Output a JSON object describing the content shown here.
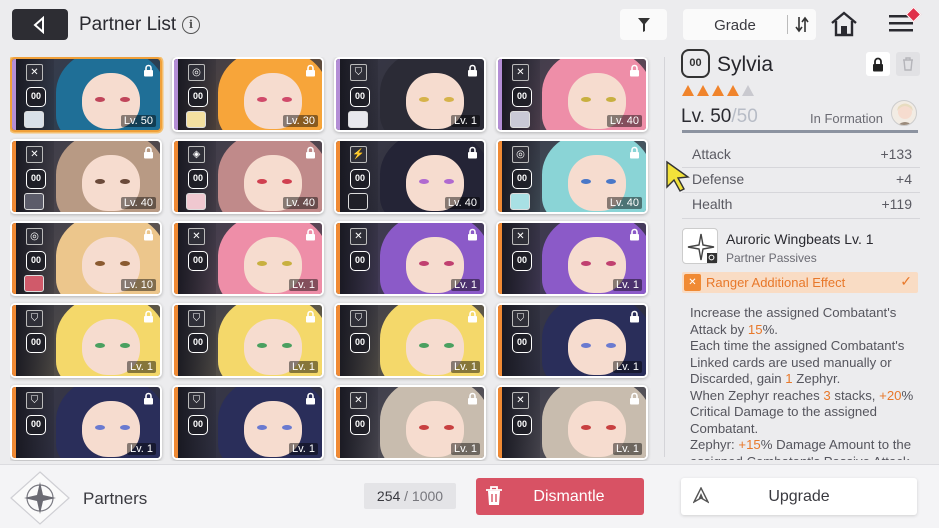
{
  "header": {
    "title": "Partner List",
    "info_glyph": "i",
    "sort_label": "Grade"
  },
  "partners": [
    {
      "level": "Lv. 50",
      "hair": "#1f6f97",
      "eye": "#c0455a",
      "strip": "#b48ed6",
      "class": "✕",
      "avatar": "#d8e0e8",
      "selected": true
    },
    {
      "level": "Lv. 30",
      "hair": "#f7a53a",
      "eye": "#d04a6a",
      "strip": "#b48ed6",
      "class": "◎",
      "avatar": "#f4e0a0"
    },
    {
      "level": "Lv. 1",
      "hair": "#2b2b36",
      "eye": "#d6b34a",
      "strip": "#b48ed6",
      "class": "⛉",
      "avatar": "#e8e8ee"
    },
    {
      "level": "Lv. 40",
      "hair": "#ee8ea8",
      "eye": "#c8b040",
      "strip": "#b48ed6",
      "class": "✕",
      "avatar": "#c9c9d6"
    },
    {
      "level": "Lv. 40",
      "hair": "#b89a84",
      "eye": "#6b4a3a",
      "strip": "#f08a34",
      "class": "✕",
      "avatar": "#5c5c6a"
    },
    {
      "level": "Lv. 40",
      "hair": "#c08a8a",
      "eye": "#d04050",
      "strip": "#f08a34",
      "class": "◈",
      "avatar": "#f0c8d0"
    },
    {
      "level": "Lv. 40",
      "hair": "#242436",
      "eye": "#b06ad0",
      "strip": "#f08a34",
      "class": "⚡",
      "avatar": "#202028"
    },
    {
      "level": "Lv. 40",
      "hair": "#8ad4d6",
      "eye": "#4a78c8",
      "strip": "#f08a34",
      "class": "◎",
      "avatar": "#a8e0e4"
    },
    {
      "level": "Lv. 10",
      "hair": "#ecc68c",
      "eye": "#8a5a30",
      "strip": "#f08a34",
      "class": "◎",
      "avatar": "#d05a6a"
    },
    {
      "level": "Lv. 1",
      "hair": "#ee8ea8",
      "eye": "#c8b040",
      "strip": "#f08a34",
      "class": "✕",
      "avatar": "#000000"
    },
    {
      "level": "Lv. 1",
      "hair": "#8b5ac8",
      "eye": "#c04070",
      "strip": "#f08a34",
      "class": "✕",
      "avatar": "#000000"
    },
    {
      "level": "Lv. 1",
      "hair": "#8b5ac8",
      "eye": "#c04070",
      "strip": "#f08a34",
      "class": "✕",
      "avatar": "#000000"
    },
    {
      "level": "Lv. 1",
      "hair": "#f4d86a",
      "eye": "#4aa060",
      "strip": "#f08a34",
      "class": "⛉",
      "avatar": "#000000"
    },
    {
      "level": "Lv. 1",
      "hair": "#f4d86a",
      "eye": "#4aa060",
      "strip": "#f08a34",
      "class": "⛉",
      "avatar": "#000000"
    },
    {
      "level": "Lv. 1",
      "hair": "#f4d86a",
      "eye": "#4aa060",
      "strip": "#f08a34",
      "class": "⛉",
      "avatar": "#000000"
    },
    {
      "level": "Lv. 1",
      "hair": "#2a2e5a",
      "eye": "#6a7ad0",
      "strip": "#f08a34",
      "class": "⛉",
      "avatar": "#000000"
    },
    {
      "level": "Lv. 1",
      "hair": "#2a2e5a",
      "eye": "#6a7ad0",
      "strip": "#f08a34",
      "class": "⛉",
      "avatar": "#000000"
    },
    {
      "level": "Lv. 1",
      "hair": "#2a2e5a",
      "eye": "#6a7ad0",
      "strip": "#f08a34",
      "class": "⛉",
      "avatar": "#000000"
    },
    {
      "level": "Lv. 1",
      "hair": "#c8bcae",
      "eye": "#c84040",
      "strip": "#f08a34",
      "class": "✕",
      "avatar": "#000000"
    },
    {
      "level": "Lv. 1",
      "hair": "#c8bcae",
      "eye": "#c84040",
      "strip": "#f08a34",
      "class": "✕",
      "avatar": "#000000"
    }
  ],
  "partner_id_label": "00",
  "detail": {
    "name": "Sylvia",
    "stars_filled": 4,
    "stars_total": 5,
    "level_current": "Lv. 50",
    "level_max": "/50",
    "in_formation": "In Formation",
    "stats": [
      {
        "label": "Attack",
        "value": "+133"
      },
      {
        "label": "Defense",
        "value": "+4"
      },
      {
        "label": "Health",
        "value": "+119"
      }
    ],
    "skill_title": "Auroric Wingbeats Lv. 1",
    "skill_subtitle": "Partner Passives",
    "effect_label": "Ranger Additional Effect",
    "effect_check": "✓",
    "description_html": "Increase the assigned Combatant's Attack by <span class='hl'>15</span>%.<br>Each time the assigned Combatant's Linked cards are used manually or Discarded, gain <span class='hl'>1</span> Zephyr.<br>When Zephyr reaches <span class='hl'>3</span> stacks, <span class='hl'>+20</span>% Critical Damage to the assigned Combatant.<br>Zephyr: <span class='hl'>+15</span>% Damage Amount to the assigned Combatant's Passive Attack"
  },
  "footer": {
    "section_label": "Partners",
    "count_current": "254",
    "count_sep": " / 1000",
    "dismantle_label": "Dismantle",
    "upgrade_label": "Upgrade"
  },
  "colors": {
    "accent_orange": "#f08a34",
    "dismantle_red": "#d85264",
    "selected_border": "#f0a03a"
  }
}
